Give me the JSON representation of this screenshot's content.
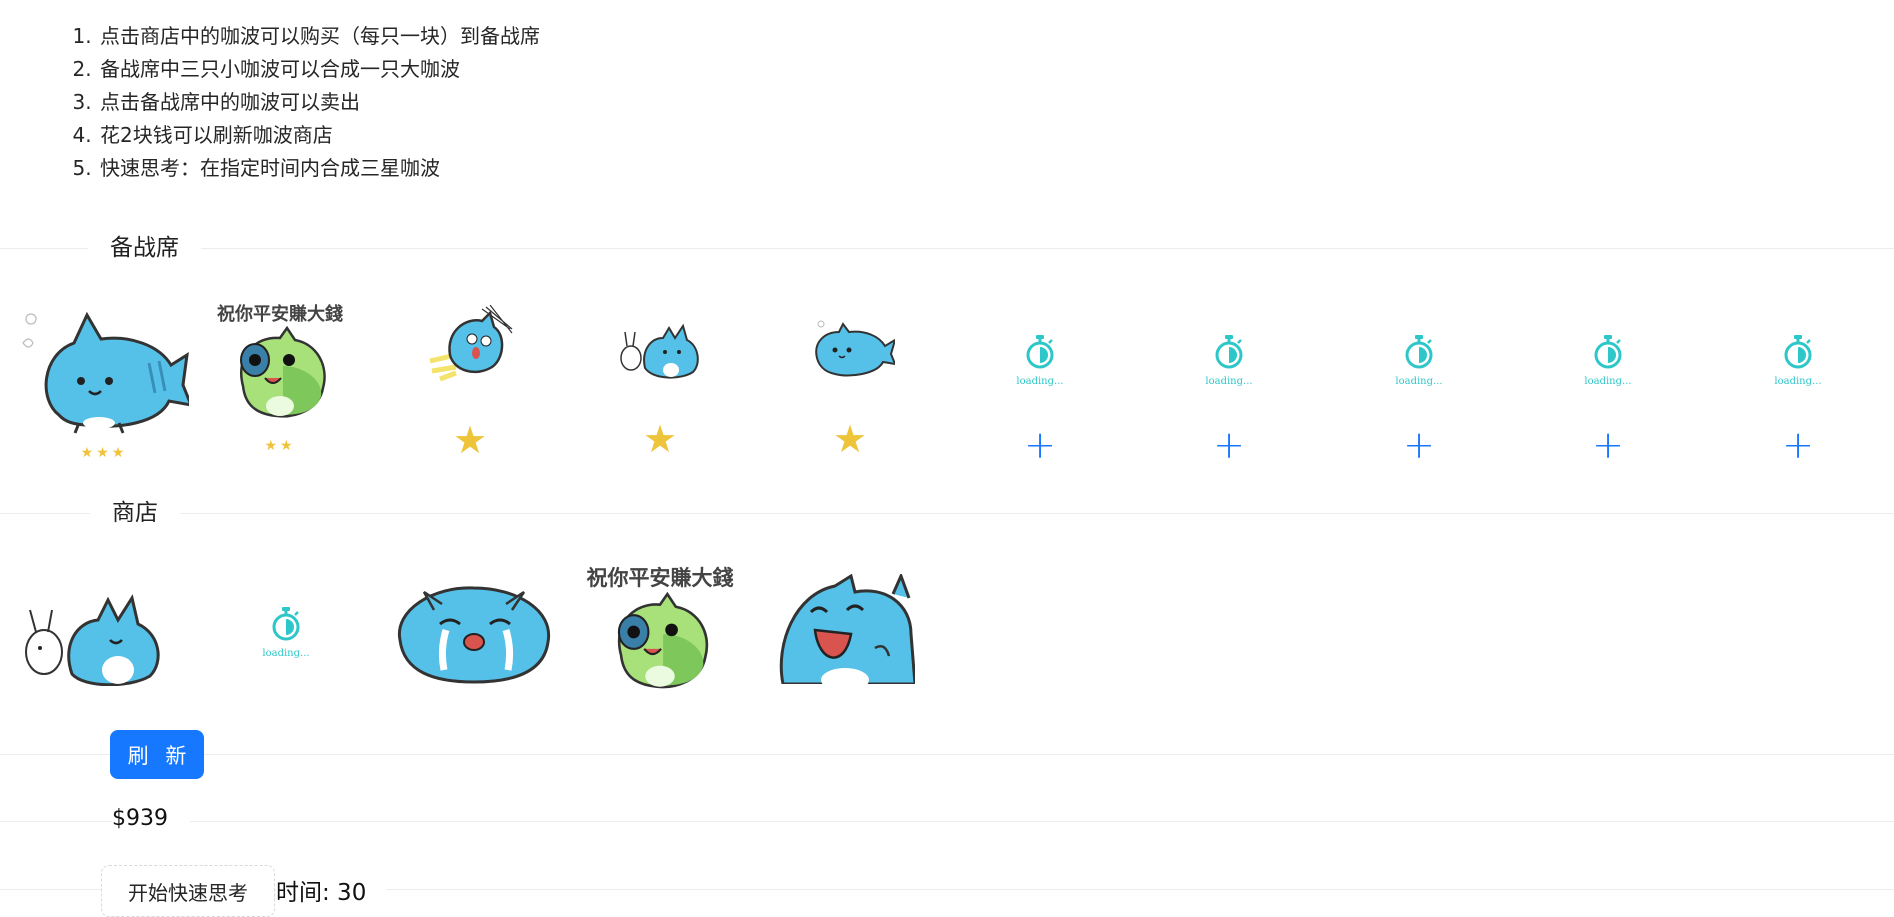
{
  "rules": [
    "点击商店中的咖波可以购买（每只一块）到备战席",
    "备战席中三只小咖波可以合成一只大咖波",
    "点击备战席中的咖波可以卖出",
    "花2块钱可以刷新咖波商店",
    "快速思考：在指定时间内合成三星咖波"
  ],
  "bench": {
    "label": "备战席",
    "slots": [
      {
        "kind": "blue-fish-cat",
        "stars": "★★★"
      },
      {
        "kind": "green-frog-cat",
        "caption": "祝你平安賺大錢",
        "stars": "★★"
      },
      {
        "kind": "shocked-cat",
        "stars": "★"
      },
      {
        "kind": "bunny-cat",
        "stars": "★"
      },
      {
        "kind": "fish-cat-small",
        "stars": "★"
      },
      {
        "kind": "loading",
        "loading_text": "loading...",
        "add": "+"
      },
      {
        "kind": "loading",
        "loading_text": "loading...",
        "add": "+"
      },
      {
        "kind": "loading",
        "loading_text": "loading...",
        "add": "+"
      },
      {
        "kind": "loading",
        "loading_text": "loading...",
        "add": "+"
      },
      {
        "kind": "loading",
        "loading_text": "loading...",
        "add": "+"
      }
    ]
  },
  "shop": {
    "label": "商店",
    "items": [
      {
        "kind": "bunny-cat"
      },
      {
        "kind": "loading",
        "loading_text": "loading..."
      },
      {
        "kind": "crying-cat"
      },
      {
        "kind": "green-frog-cat",
        "caption": "祝你平安賺大錢"
      },
      {
        "kind": "laughing-cat"
      }
    ],
    "refresh_label": "刷 新"
  },
  "money": "$939",
  "quick_think": {
    "button_label": "开始快速思考",
    "timer_text": "时间: 30"
  },
  "colors": {
    "accent": "#1677ff",
    "star": "#f0c23a",
    "loading": "#2ec7c9",
    "cat_blue": "#56c1e8",
    "cat_green": "#a8e07a"
  }
}
